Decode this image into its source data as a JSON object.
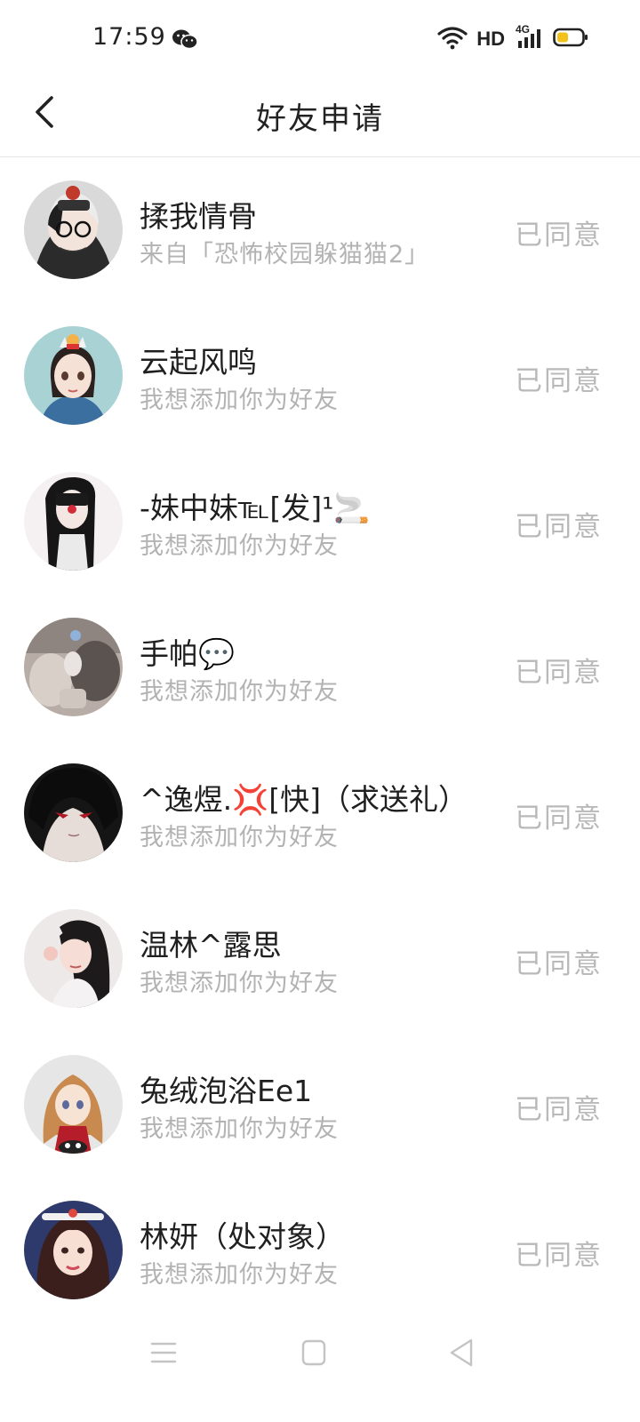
{
  "status_bar": {
    "time": "17:59",
    "network": "HD",
    "signal_badge": "4G"
  },
  "header": {
    "title": "好友申请"
  },
  "requests": [
    {
      "name": "揉我情骨",
      "subtext": "来自「恐怖校园躲猫猫2」",
      "status": "已同意"
    },
    {
      "name": "云起风鸣",
      "subtext": "我想添加你为好友",
      "status": "已同意"
    },
    {
      "name": "-妹中妹℡[发]¹🚬",
      "subtext": "我想添加你为好友",
      "status": "已同意"
    },
    {
      "name": "手帕💬",
      "subtext": "我想添加你为好友",
      "status": "已同意"
    },
    {
      "name": "^逸煜.💢[快]（求送礼）",
      "subtext": "我想添加你为好友",
      "status": "已同意"
    },
    {
      "name": "温林^露思",
      "subtext": "我想添加你为好友",
      "status": "已同意"
    },
    {
      "name": "兔绒泡浴Ee1",
      "subtext": "我想添加你为好友",
      "status": "已同意"
    },
    {
      "name": "林妍（处对象）",
      "subtext": "我想添加你为好友",
      "status": "已同意"
    }
  ]
}
